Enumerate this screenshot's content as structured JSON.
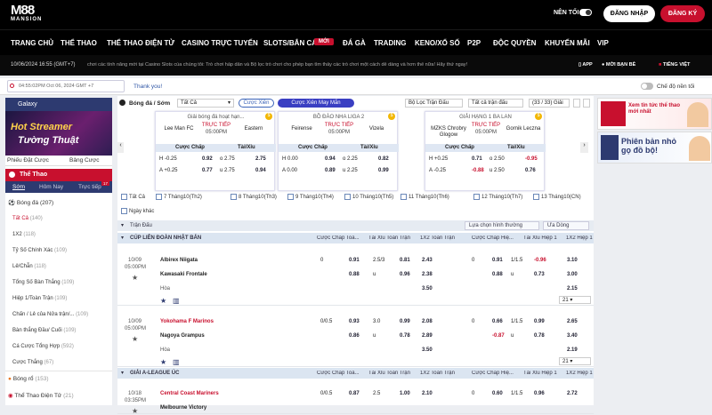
{
  "brand": {
    "logo_main": "M88",
    "logo_sub": "MANSION"
  },
  "header": {
    "new_label": "NÊN TỐI",
    "login": "ĐĂNG NHẬP",
    "register": "ĐĂNG KÝ"
  },
  "nav": [
    "TRANG CHỦ",
    "THỂ THAO",
    "THỂ THAO ĐIỆN TỬ",
    "CASINO TRỰC TUYẾN",
    "SLOTS/BẮN CÁ",
    "ĐÁ GÀ",
    "TRADING",
    "KENO/XỔ SỐ",
    "P2P",
    "ĐỘC QUYỀN",
    "KHUYẾN MÃI",
    "VIP"
  ],
  "nav_badge": "MỚI",
  "info": {
    "datetime": "10/06/2024 16:55 (GMT+7)",
    "ticker": "chơi các tính năng mới tại Casino Slots của chúng tôi: Trò chơi hấp dẫn và Bộ lọc trò chơi cho phép bạn tìm thấy các trò chơi một cách dễ dàng và hơn thế nữa! Hãy thử ngay!",
    "app": "APP",
    "refer": "MỜI BẠN BÈ",
    "lang": "TIẾNG VIỆT"
  },
  "searchbar": {
    "time": "04:55:02PM Oct 06, 2024 GMT +7",
    "thanks": "Thank you!",
    "night_mode": "Chế độ nền tối"
  },
  "left": {
    "galaxy": "Galaxy",
    "banner_line1": "Hot Streamer",
    "banner_line2": "Tường Thuật",
    "tab1": "Phiếu Đặt Cược",
    "tab2": "Bảng Cược",
    "sport_header": "Thể Thao",
    "sub_tabs": [
      "Sớm",
      "Hôm Nay",
      "Trực tiếp"
    ],
    "live_badge": "17",
    "items": [
      {
        "label": "Bóng đá",
        "count": "(207)"
      },
      {
        "label": "Tất Cả",
        "count": "(140)"
      },
      {
        "label": "1X2",
        "count": "(118)"
      },
      {
        "label": "Tỷ Số Chính Xác",
        "count": "(109)"
      },
      {
        "label": "Lẻ/Chẵn",
        "count": "(118)"
      },
      {
        "label": "Tổng Số Bàn Thắng",
        "count": "(109)"
      },
      {
        "label": "Hiệp 1/Toàn Trận",
        "count": "(109)"
      },
      {
        "label": "Chấn / Lẻ của Nửa trận/...",
        "count": "(109)"
      },
      {
        "label": "Bàn thắng Đầu/ Cuối",
        "count": "(109)"
      },
      {
        "label": "Cá Cược Tổng Hợp",
        "count": "(592)"
      },
      {
        "label": "Cược Thắng",
        "count": "(67)"
      },
      {
        "label": "Bóng rổ",
        "count": "(153)"
      },
      {
        "label": "Thể Thao Điện Tử",
        "count": "(21)"
      }
    ]
  },
  "toolbar": {
    "title": "Bóng đá / Sớm",
    "select_all": "Tất Cả",
    "cuoc_xien": "Cược Xiên",
    "cuoc_xien_may_man": "Cược Xiên May Mắn",
    "filter": "Bộ Lọc Trận Đấu",
    "all_matches": "Tất cả trận đấu",
    "count": "(33 / 33) Giải"
  },
  "featured": [
    {
      "league": "Giải bóng đá hoạt hạn...",
      "home": "Lee Man FC",
      "away": "Eastern",
      "status": "TRỰC TIẾP",
      "time": "05:00PM",
      "h1": "H -0.25",
      "o1": "0.92",
      "t1": "o 2.75",
      "o2": "2.75",
      "h2": "A +0.25",
      "o3": "0.77",
      "t2": "u 2.75",
      "o4": "0.94"
    },
    {
      "league": "BỒ ĐÀO NHA LIGA 2",
      "home": "Feirense",
      "away": "Vizela",
      "status": "TRỰC TIẾP",
      "time": "05:00PM",
      "h1": "H 0.00",
      "o1": "0.94",
      "t1": "o 2.25",
      "o2": "0.82",
      "h2": "A 0.00",
      "o3": "0.89",
      "t2": "u 2.25",
      "o4": "0.99"
    },
    {
      "league": "GIẢI HẠNG 1 BA LAN",
      "home": "MZKS Chrobry Glogow",
      "away": "Gornik Leczna",
      "status": "TRỰC TIẾP",
      "time": "05:00PM",
      "h1": "H +0.25",
      "o1": "0.71",
      "t1": "o 2.50",
      "o2": "-0.95",
      "h2": "A -0.25",
      "o3": "-0.88",
      "t2": "u 2.50",
      "o4": "0.76"
    }
  ],
  "featured_cols": {
    "handicap": "Cược Chấp",
    "ou": "Tài/Xỉu"
  },
  "days": [
    "Tất Cả",
    "7 Tháng10(Th2)",
    "8 Tháng10(Th3)",
    "9 Tháng10(Th4)",
    "10 Tháng10(Th5)",
    "11 Tháng10(Th6)",
    "12 Tháng10(Th7)",
    "13 Tháng10(CN)",
    "Ngày khác"
  ],
  "list": {
    "header": "Trận Đấu",
    "sort": "Lựa chọn hình thường",
    "view": "Ưa Dòng",
    "cols": [
      "Cược Chấp Toà...",
      "Tài Xỉu Toàn Trận",
      "1X2 Toàn Trận",
      "Cược Chấp Hiệ...",
      "Tài Xỉu Hiệp 1",
      "1X2 Hiệp 1"
    ]
  },
  "leagues": [
    {
      "name": "CÚP LIÊN ĐOÀN NHẬT BẢN"
    },
    {
      "name": "GIẢI A-LEAGUE ÚC"
    }
  ],
  "matches": [
    {
      "date": "10/09",
      "time": "05:00PM",
      "home": "Albirex Niigata",
      "away": "Kawasaki Frontale",
      "draw": "Hòa",
      "r1": [
        "0",
        "0.91",
        "2.5/3",
        "0.81",
        "2.43",
        "0",
        "0.91",
        "1/1.5",
        "-0.96",
        "3.10"
      ],
      "r2": [
        "",
        "0.88",
        "u",
        "0.96",
        "2.38",
        "",
        "0.88",
        "u",
        "0.73",
        "3.00"
      ],
      "d1": "3.50",
      "d2": "2.15",
      "more": "21"
    },
    {
      "date": "10/09",
      "time": "05:00PM",
      "home": "Yokohama F Marinos",
      "away": "Nagoya Grampus",
      "draw": "Hòa",
      "r1": [
        "0/0.5",
        "0.93",
        "3.0",
        "0.99",
        "2.08",
        "0",
        "0.66",
        "1/1.5",
        "0.99",
        "2.65"
      ],
      "r2": [
        "",
        "0.86",
        "u",
        "0.78",
        "2.89",
        "",
        "-0.87",
        "u",
        "0.78",
        "3.40"
      ],
      "d1": "3.50",
      "d2": "2.19",
      "more": "21"
    },
    {
      "date": "10/18",
      "time": "03:35PM",
      "home": "Central Coast Mariners",
      "away": "Melbourne Victory",
      "r1": [
        "0/0.5",
        "0.87",
        "2.5",
        "1.00",
        "2.10",
        "0",
        "0.60",
        "1/1.5",
        "0.96",
        "2.72"
      ]
    }
  ],
  "right": {
    "ad1": "Xem tin tức thể thao mới nhất",
    "ad2": "Phiên bản nhỏ gọ đồ bộ!"
  }
}
